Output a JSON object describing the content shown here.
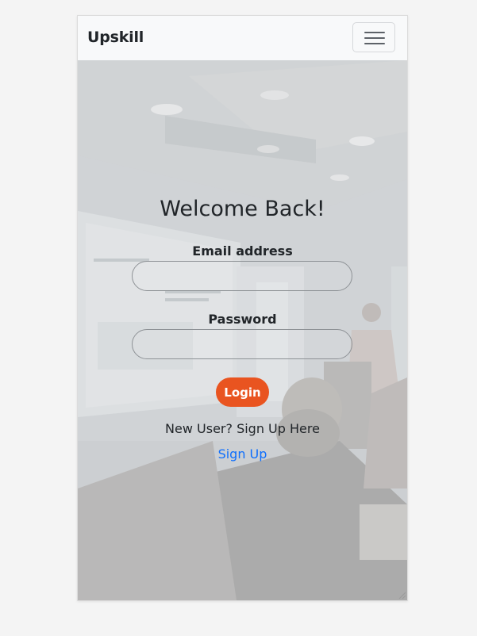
{
  "navbar": {
    "brand": "Upskill",
    "toggler_icon": "hamburger-menu-icon"
  },
  "login": {
    "title": "Welcome Back!",
    "email_label": "Email address",
    "email_value": "",
    "password_label": "Password",
    "password_value": "",
    "submit_label": "Login",
    "signup_prompt": "New User? Sign Up Here",
    "signup_link": "Sign Up"
  },
  "colors": {
    "accent": "#e95420",
    "link": "#0d6efd",
    "navbar_bg": "#f8f9fa",
    "text": "#212529"
  }
}
